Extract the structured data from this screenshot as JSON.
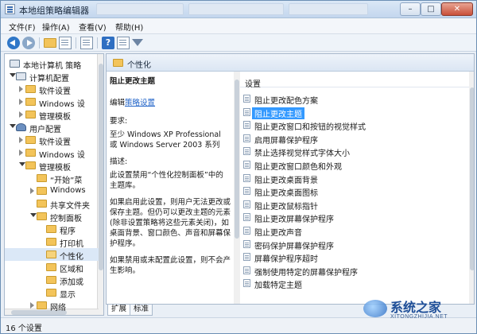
{
  "window": {
    "title": "本地组策略编辑器"
  },
  "menu": [
    "文件(F)",
    "操作(A)",
    "查看(V)",
    "帮助(H)"
  ],
  "tree": {
    "items": [
      {
        "label": "本地计算机 策略",
        "level": 0,
        "icon": "pc",
        "arrow": "none"
      },
      {
        "label": "计算机配置",
        "level": 1,
        "icon": "pc",
        "arrow": "open"
      },
      {
        "label": "软件设置",
        "level": 2,
        "icon": "folder",
        "arrow": "closed"
      },
      {
        "label": "Windows 设",
        "level": 2,
        "icon": "folder",
        "arrow": "closed"
      },
      {
        "label": "管理模板",
        "level": 2,
        "icon": "folder",
        "arrow": "closed"
      },
      {
        "label": "用户配置",
        "level": 1,
        "icon": "user",
        "arrow": "open"
      },
      {
        "label": "软件设置",
        "level": 2,
        "icon": "folder",
        "arrow": "closed"
      },
      {
        "label": "Windows 设",
        "level": 2,
        "icon": "folder",
        "arrow": "closed"
      },
      {
        "label": "管理模板",
        "level": 2,
        "icon": "folder",
        "arrow": "open"
      },
      {
        "label": "“开始”菜",
        "level": 3,
        "icon": "folder",
        "arrow": "none"
      },
      {
        "label": "Windows",
        "level": 3,
        "icon": "folder",
        "arrow": "closed"
      },
      {
        "label": "共享文件夹",
        "level": 3,
        "icon": "folder",
        "arrow": "none"
      },
      {
        "label": "控制面板",
        "level": 3,
        "icon": "folder",
        "arrow": "open"
      },
      {
        "label": "程序",
        "level": 4,
        "icon": "folder",
        "arrow": "none"
      },
      {
        "label": "打印机",
        "level": 4,
        "icon": "folder",
        "arrow": "none"
      },
      {
        "label": "个性化",
        "level": 4,
        "icon": "folder",
        "arrow": "none",
        "selected": true
      },
      {
        "label": "区域和",
        "level": 4,
        "icon": "folder",
        "arrow": "none"
      },
      {
        "label": "添加或",
        "level": 4,
        "icon": "folder",
        "arrow": "none"
      },
      {
        "label": "显示",
        "level": 4,
        "icon": "folder",
        "arrow": "none"
      },
      {
        "label": "网络",
        "level": 3,
        "icon": "folder",
        "arrow": "closed"
      }
    ]
  },
  "content": {
    "header": "个性化",
    "desc_title": "阻止更改主题",
    "edit_prefix": "编辑",
    "edit_link": "策略设置",
    "req_label": "要求:",
    "req_text": "至少 Windows XP Professional 或 Windows Server 2003 系列",
    "desc_label": "描述:",
    "desc_text": "此设置禁用“个性化控制面板”中的主题库。",
    "desc_p2": "如果启用此设置，则用户无法更改或保存主题。但仍可以更改主题的元素(除非设置策略将这些元素关闭)，如桌面背景、窗口颜色、声音和屏幕保护程序。",
    "desc_p3": "如果禁用或未配置此设置，则不会产生影响。",
    "list_header": "设置",
    "items": [
      "阻止更改配色方案",
      "阻止更改主题",
      "阻止更改窗口和按钮的视觉样式",
      "启用屏幕保护程序",
      "禁止选择视觉样式字体大小",
      "阻止更改窗口颜色和外观",
      "阻止更改桌面背景",
      "阻止更改桌面图标",
      "阻止更改鼠标指针",
      "阻止更改屏幕保护程序",
      "阻止更改声音",
      "密码保护屏幕保护程序",
      "屏幕保护程序超时",
      "强制使用特定的屏幕保护程序",
      "加载特定主题"
    ],
    "selected_index": 1
  },
  "tabs": [
    "扩展",
    "标准"
  ],
  "status": "16 个设置",
  "watermark": {
    "cn": "系统之家",
    "en": "XITONGZHIJIA.NET"
  }
}
